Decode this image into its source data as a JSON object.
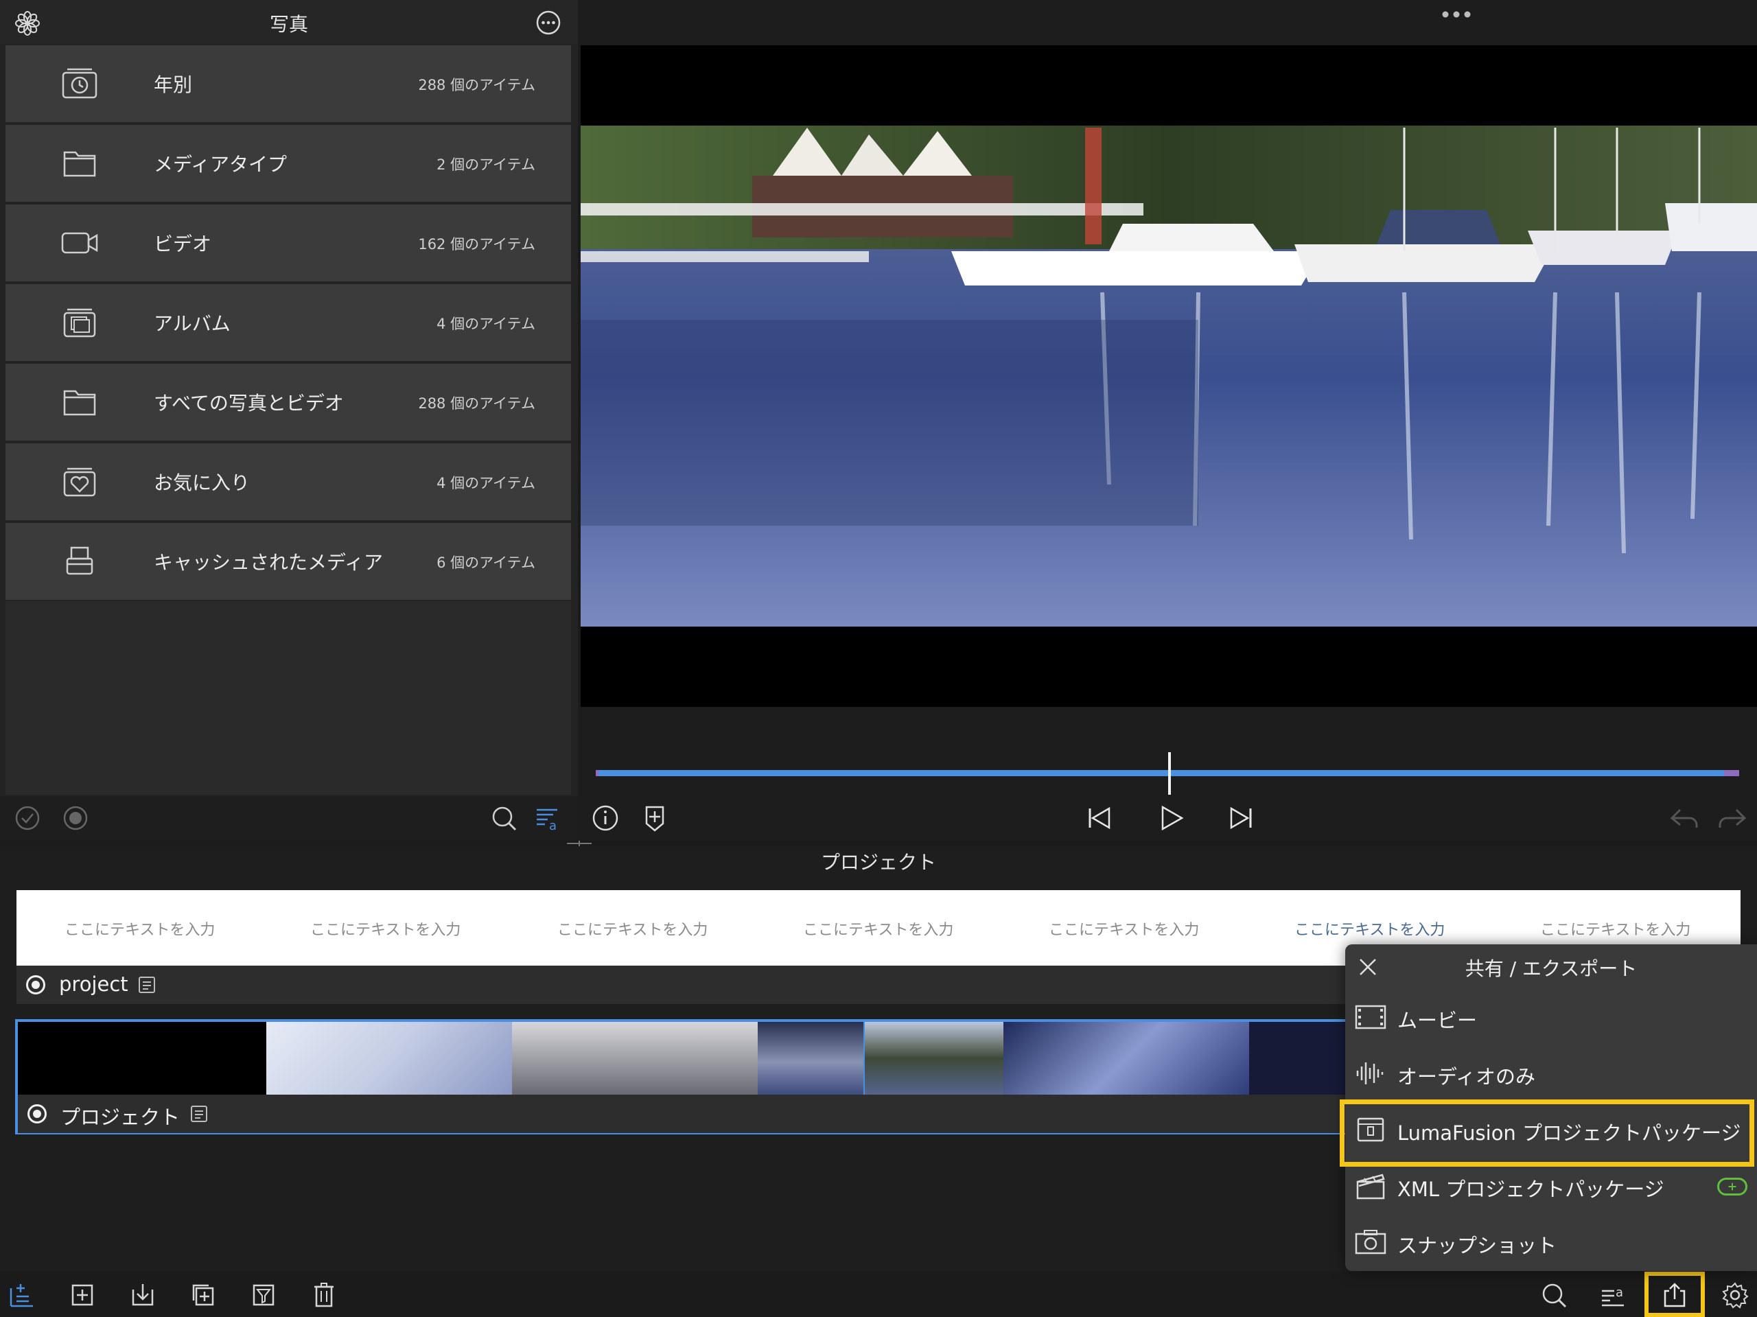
{
  "library": {
    "title": "写真",
    "logo_icon": "flower-icon",
    "more_icon": "ellipsis-circle-icon",
    "items": [
      {
        "icon": "calendar-clock-icon",
        "label": "年別",
        "count": "288 個のアイテム"
      },
      {
        "icon": "folder-icon",
        "label": "メディアタイプ",
        "count": "2 個のアイテム"
      },
      {
        "icon": "video-camera-icon",
        "label": "ビデオ",
        "count": "162 個のアイテム"
      },
      {
        "icon": "album-icon",
        "label": "アルバム",
        "count": "4 個のアイテム"
      },
      {
        "icon": "folder-icon",
        "label": "すべての写真とビデオ",
        "count": "288 個のアイテム"
      },
      {
        "icon": "heart-folder-icon",
        "label": "お気に入り",
        "count": "4 個のアイテム"
      },
      {
        "icon": "cache-drive-icon",
        "label": "キャッシュされたメディア",
        "count": "6 個のアイテム"
      }
    ],
    "footer_icons": [
      "check-circle-icon",
      "record-circle-icon",
      "search-icon",
      "sort-icon"
    ]
  },
  "viewer": {
    "more_icon": "ellipsis-icon",
    "playhead_fraction": 0.5,
    "controls": [
      "info-icon",
      "add-marker-icon",
      "skip-back-icon",
      "play-icon",
      "skip-forward-icon",
      "undo-icon",
      "redo-icon"
    ]
  },
  "timeline": {
    "title": "プロジェクト",
    "title_strip": [
      "ここにテキストを入力",
      "ここにテキストを入力",
      "ここにテキストを入力",
      "ここにテキストを入力",
      "ここにテキストを入力",
      "ここにテキストを入力",
      "ここにテキストを入力"
    ],
    "title_track_name": "project",
    "video_track_name": "プロジェクト"
  },
  "toolbar": {
    "left_icons": [
      "new-project-icon",
      "add-icon",
      "import-icon",
      "duplicate-icon",
      "filter-icon",
      "trash-icon"
    ],
    "right_icons": [
      "search-icon",
      "sort-icon",
      "share-icon",
      "settings-icon"
    ]
  },
  "export_menu": {
    "title": "共有 / エクスポート",
    "close_icon": "close-icon",
    "items": [
      {
        "icon": "film-strip-icon",
        "label": "ムービー"
      },
      {
        "icon": "waveform-icon",
        "label": "オーディオのみ"
      },
      {
        "icon": "package-icon",
        "label": "LumaFusion プロジェクトパッケージ"
      },
      {
        "icon": "clapperboard-icon",
        "label": "XML プロジェクトパッケージ"
      },
      {
        "icon": "camera-icon",
        "label": "スナップショット"
      }
    ],
    "highlighted": "LumaFusion プロジェクトパッケージ"
  },
  "colors": {
    "accent": "#4a90e2",
    "highlight": "#f5c518",
    "purple_marker": "#8e6cc0",
    "plus_green": "#5fbf3f"
  }
}
